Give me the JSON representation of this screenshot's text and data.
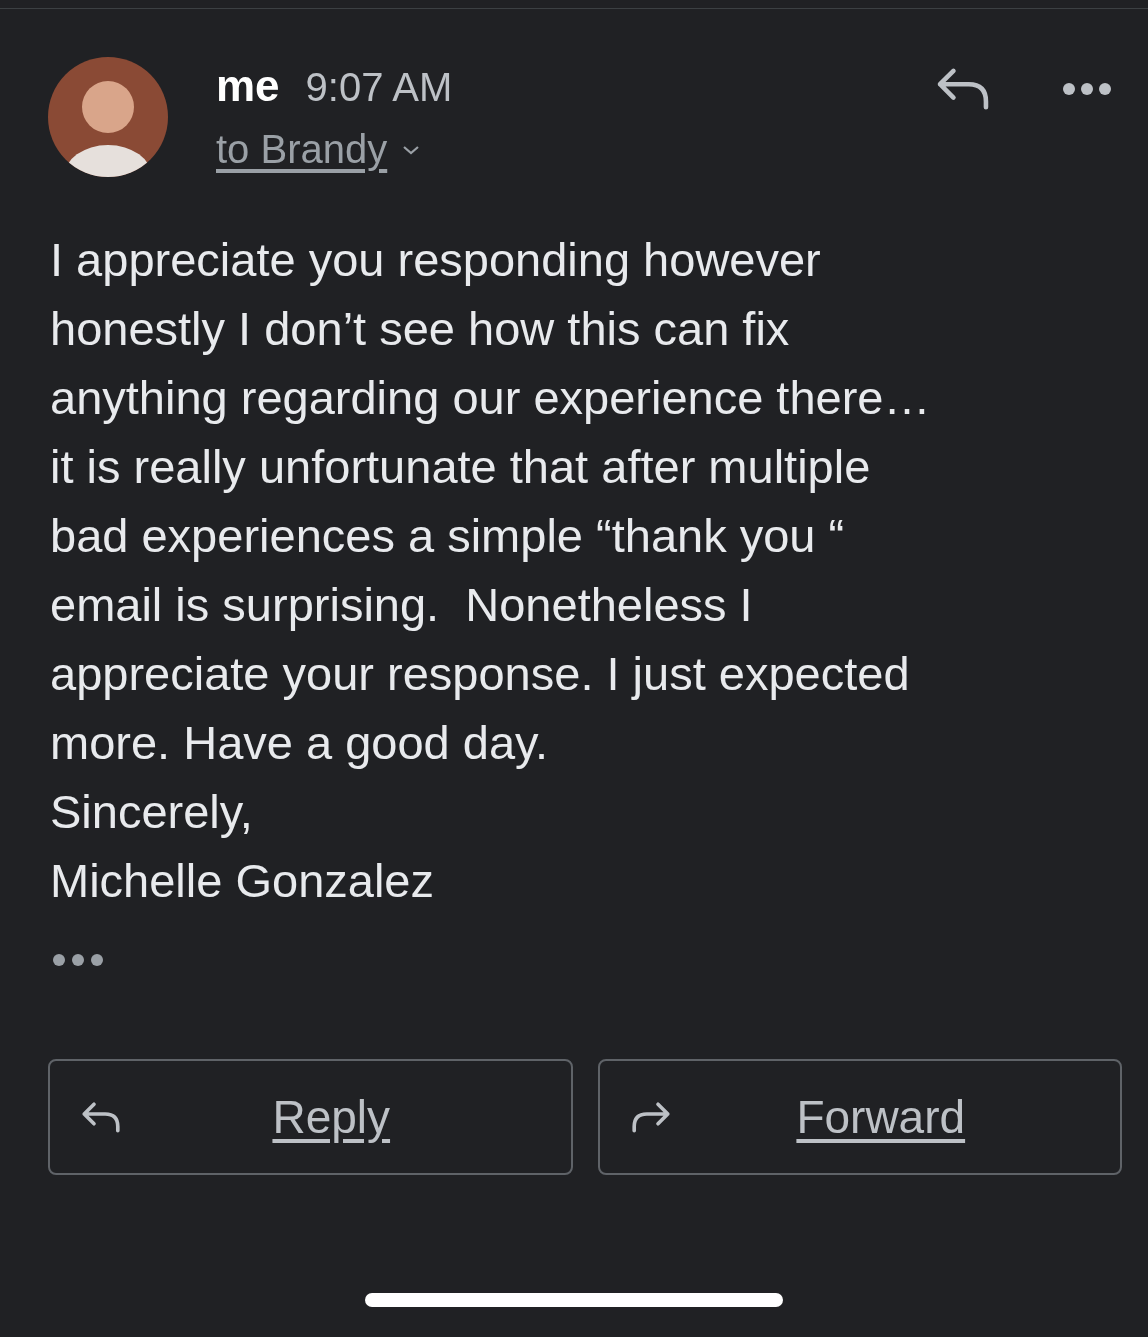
{
  "header": {
    "sender": "me",
    "time": "9:07 AM",
    "recipient": "to Brandy"
  },
  "body_lines": [
    "I appreciate you responding however",
    "honestly I don’t see how this can fix",
    "anything regarding our experience there…",
    "it is really unfortunate that after multiple",
    "bad experiences a simple “thank you “",
    "email is surprising.  Nonetheless I",
    "appreciate your response. I just expected",
    "more. Have a good day.",
    "Sincerely,",
    "Michelle Gonzalez"
  ],
  "actions": [
    {
      "kind": "reply",
      "label": "Reply"
    },
    {
      "kind": "forward",
      "label": "Forward"
    }
  ]
}
